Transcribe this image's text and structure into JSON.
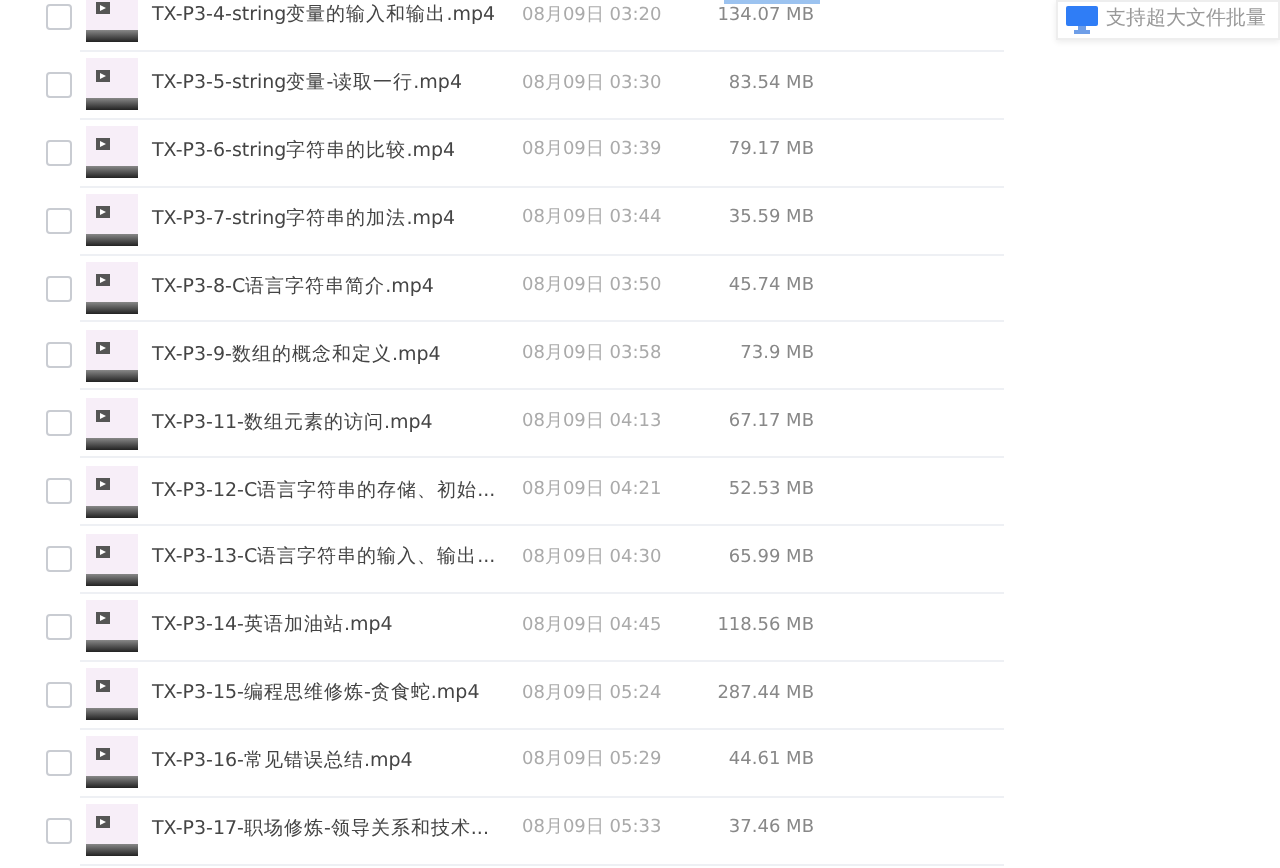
{
  "promo": {
    "text": "支持超大文件批量"
  },
  "files": [
    {
      "name": "TX-P3-4-string变量的输入和输出.mp4",
      "date": "08月09日 03:20",
      "size": "134.07 MB",
      "checked": false
    },
    {
      "name": "TX-P3-5-string变量-读取一行.mp4",
      "date": "08月09日 03:30",
      "size": "83.54 MB",
      "checked": false
    },
    {
      "name": "TX-P3-6-string字符串的比较.mp4",
      "date": "08月09日 03:39",
      "size": "79.17 MB",
      "checked": false
    },
    {
      "name": "TX-P3-7-string字符串的加法.mp4",
      "date": "08月09日 03:44",
      "size": "35.59 MB",
      "checked": false
    },
    {
      "name": "TX-P3-8-C语言字符串简介.mp4",
      "date": "08月09日 03:50",
      "size": "45.74 MB",
      "checked": false
    },
    {
      "name": "TX-P3-9-数组的概念和定义.mp4",
      "date": "08月09日 03:58",
      "size": "73.9 MB",
      "checked": false
    },
    {
      "name": "TX-P3-11-数组元素的访问.mp4",
      "date": "08月09日 04:13",
      "size": "67.17 MB",
      "checked": false
    },
    {
      "name": "TX-P3-12-C语言字符串的存储、初始...",
      "date": "08月09日 04:21",
      "size": "52.53 MB",
      "checked": false
    },
    {
      "name": "TX-P3-13-C语言字符串的输入、输出...",
      "date": "08月09日 04:30",
      "size": "65.99 MB",
      "checked": false
    },
    {
      "name": "TX-P3-14-英语加油站.mp4",
      "date": "08月09日 04:45",
      "size": "118.56 MB",
      "checked": false
    },
    {
      "name": "TX-P3-15-编程思维修炼-贪食蛇.mp4",
      "date": "08月09日 05:24",
      "size": "287.44 MB",
      "checked": false
    },
    {
      "name": "TX-P3-16-常见错误总结.mp4",
      "date": "08月09日 05:29",
      "size": "44.61 MB",
      "checked": false
    },
    {
      "name": "TX-P3-17-职场修炼-领导关系和技术...",
      "date": "08月09日 05:33",
      "size": "37.46 MB",
      "checked": false
    }
  ]
}
